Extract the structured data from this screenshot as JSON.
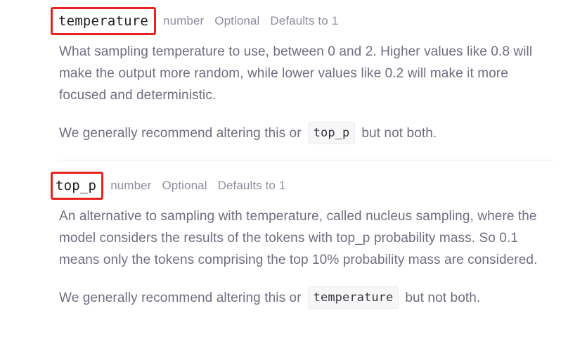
{
  "params": [
    {
      "name": "temperature",
      "type": "number",
      "optional": "Optional",
      "default": "Defaults to 1",
      "description": "What sampling temperature to use, between 0 and 2. Higher values like 0.8 will make the output more random, while lower values like 0.2 will make it more focused and deterministic.",
      "recommend_prefix": "We generally recommend altering this or",
      "recommend_code": "top_p",
      "recommend_suffix": "but not both."
    },
    {
      "name": "top_p",
      "type": "number",
      "optional": "Optional",
      "default": "Defaults to 1",
      "description": "An alternative to sampling with temperature, called nucleus sampling, where the model considers the results of the tokens with top_p probability mass. So 0.1 means only the tokens comprising the top 10% probability mass are considered.",
      "recommend_prefix": "We generally recommend altering this or",
      "recommend_code": "temperature",
      "recommend_suffix": "but not both."
    }
  ],
  "colors": {
    "highlight_border": "#e8231f",
    "meta_text": "#8e8ea0",
    "body_text": "#6e6e80",
    "divider": "#ececf1"
  }
}
